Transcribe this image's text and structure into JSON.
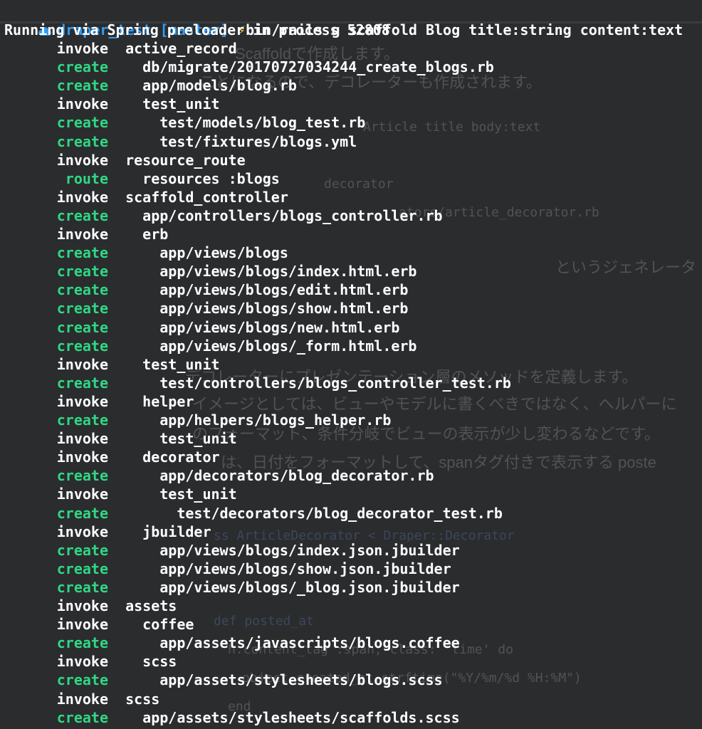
{
  "prompt": {
    "directory": "draper_test",
    "branch": "[master]",
    "bolt": "⚡",
    "command": "bin/rails g scaffold Blog title:string content:text",
    "cloud_icon": "cloud-icon",
    "dir_color": "#2f9df7",
    "bolt_color": "#f7c52f"
  },
  "spring_message": "Running via Spring preloader in process 52808",
  "colors": {
    "create": "#2fd885",
    "invoke": "#ffffff",
    "background": "#2b2c2e"
  },
  "output": [
    {
      "action": "invoke",
      "indent": 1,
      "text": "active_record"
    },
    {
      "action": "create",
      "indent": 2,
      "text": "db/migrate/20170727034244_create_blogs.rb"
    },
    {
      "action": "create",
      "indent": 2,
      "text": "app/models/blog.rb"
    },
    {
      "action": "invoke",
      "indent": 2,
      "text": "test_unit"
    },
    {
      "action": "create",
      "indent": 3,
      "text": "test/models/blog_test.rb"
    },
    {
      "action": "create",
      "indent": 3,
      "text": "test/fixtures/blogs.yml"
    },
    {
      "action": "invoke",
      "indent": 1,
      "text": "resource_route"
    },
    {
      "action": "route",
      "indent": 2,
      "text": "resources :blogs"
    },
    {
      "action": "invoke",
      "indent": 1,
      "text": "scaffold_controller"
    },
    {
      "action": "create",
      "indent": 2,
      "text": "app/controllers/blogs_controller.rb"
    },
    {
      "action": "invoke",
      "indent": 2,
      "text": "erb"
    },
    {
      "action": "create",
      "indent": 3,
      "text": "app/views/blogs"
    },
    {
      "action": "create",
      "indent": 3,
      "text": "app/views/blogs/index.html.erb"
    },
    {
      "action": "create",
      "indent": 3,
      "text": "app/views/blogs/edit.html.erb"
    },
    {
      "action": "create",
      "indent": 3,
      "text": "app/views/blogs/show.html.erb"
    },
    {
      "action": "create",
      "indent": 3,
      "text": "app/views/blogs/new.html.erb"
    },
    {
      "action": "create",
      "indent": 3,
      "text": "app/views/blogs/_form.html.erb"
    },
    {
      "action": "invoke",
      "indent": 2,
      "text": "test_unit"
    },
    {
      "action": "create",
      "indent": 3,
      "text": "test/controllers/blogs_controller_test.rb"
    },
    {
      "action": "invoke",
      "indent": 2,
      "text": "helper"
    },
    {
      "action": "create",
      "indent": 3,
      "text": "app/helpers/blogs_helper.rb"
    },
    {
      "action": "invoke",
      "indent": 3,
      "text": "test_unit"
    },
    {
      "action": "invoke",
      "indent": 2,
      "text": "decorator"
    },
    {
      "action": "create",
      "indent": 3,
      "text": "app/decorators/blog_decorator.rb"
    },
    {
      "action": "invoke",
      "indent": 3,
      "text": "test_unit"
    },
    {
      "action": "create",
      "indent": 4,
      "text": "test/decorators/blog_decorator_test.rb"
    },
    {
      "action": "invoke",
      "indent": 2,
      "text": "jbuilder"
    },
    {
      "action": "create",
      "indent": 3,
      "text": "app/views/blogs/index.json.jbuilder"
    },
    {
      "action": "create",
      "indent": 3,
      "text": "app/views/blogs/show.json.jbuilder"
    },
    {
      "action": "create",
      "indent": 3,
      "text": "app/views/blogs/_blog.json.jbuilder"
    },
    {
      "action": "invoke",
      "indent": 1,
      "text": "assets"
    },
    {
      "action": "invoke",
      "indent": 2,
      "text": "coffee"
    },
    {
      "action": "create",
      "indent": 3,
      "text": "app/assets/javascripts/blogs.coffee"
    },
    {
      "action": "invoke",
      "indent": 2,
      "text": "scss"
    },
    {
      "action": "create",
      "indent": 3,
      "text": "app/assets/stylesheets/blogs.scss"
    },
    {
      "action": "invoke",
      "indent": 1,
      "text": "scss"
    },
    {
      "action": "create",
      "indent": 2,
      "text": "app/assets/stylesheets/scaffolds.scss"
    }
  ]
}
